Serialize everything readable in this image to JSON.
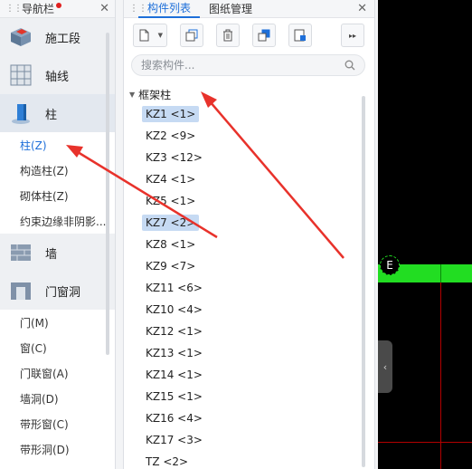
{
  "nav": {
    "title": "导航栏",
    "categories": [
      {
        "label": "施工段",
        "icon": "construction-segment-icon"
      },
      {
        "label": "轴线",
        "icon": "axis-grid-icon"
      },
      {
        "label": "柱",
        "icon": "column-icon"
      },
      {
        "label": "墙",
        "icon": "wall-icon"
      },
      {
        "label": "门窗洞",
        "icon": "door-window-icon"
      }
    ],
    "column_subitems": [
      "柱(Z)",
      "构造柱(Z)",
      "砌体柱(Z)",
      "约束边缘非阴影..."
    ],
    "door_subitems": [
      "门(M)",
      "窗(C)",
      "门联窗(A)",
      "墙洞(D)",
      "带形窗(C)",
      "带形洞(D)"
    ]
  },
  "component_panel": {
    "tabs": [
      "构件列表",
      "图纸管理"
    ],
    "search_placeholder": "搜索构件...",
    "group_label": "框架柱",
    "items": [
      "KZ1 <1>",
      "KZ2 <9>",
      "KZ3 <12>",
      "KZ4 <1>",
      "KZ5 <1>",
      "KZ7 <2>",
      "KZ8 <1>",
      "KZ9 <7>",
      "KZ11 <6>",
      "KZ10 <4>",
      "KZ12 <1>",
      "KZ13 <1>",
      "KZ14 <1>",
      "KZ15 <1>",
      "KZ16 <4>",
      "KZ17 <3>",
      "TZ <2>"
    ],
    "selected_items": [
      "KZ1 <1>",
      "KZ7 <2>"
    ]
  },
  "canvas": {
    "axis_label": "E"
  },
  "colors": {
    "accent": "#1e6fd9",
    "selection": "#c6daf3",
    "canvas_bg": "#000000",
    "beam_green": "#22dd22",
    "gridline_red": "#b30000",
    "annotation_red": "#e8322b"
  }
}
